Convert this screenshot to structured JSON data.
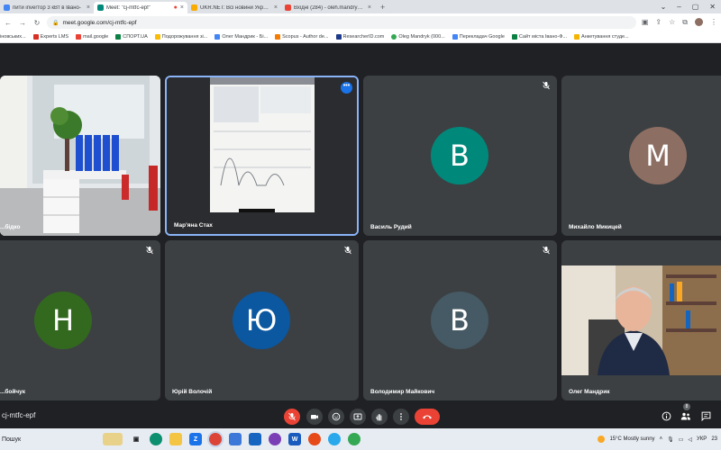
{
  "browser": {
    "tabs": [
      {
        "label": "пити inverтор 3 кВт в Івано-",
        "active": false,
        "favicon_color": "#4285f4"
      },
      {
        "label": "Meet: \"cj-mtfc-epf\"",
        "active": true,
        "favicon_color": "#00897b"
      },
      {
        "label": "UKR.NET: Всі новини України, о...",
        "active": false,
        "favicon_color": "#f9ab00"
      },
      {
        "label": "Вхідні (284) - oleh.mandryk@nu...",
        "active": false,
        "favicon_color": "#ea4335"
      }
    ],
    "new_tab": "+",
    "url": "meet.google.com/cj-mtfc-epf",
    "bookmarks": [
      {
        "label": "іновських...",
        "color": "#1a73e8"
      },
      {
        "label": "Experts LMS",
        "color": "#d93025"
      },
      {
        "label": "mail.google",
        "color": "#ea4335"
      },
      {
        "label": "СПОРТ.UA",
        "color": "#0b8043"
      },
      {
        "label": "Подорожування зі...",
        "color": "#fbbc04"
      },
      {
        "label": "Олег Мандрик - Бі...",
        "color": "#4285f4"
      },
      {
        "label": "Scopus - Author de...",
        "color": "#f57c00"
      },
      {
        "label": "ResearcherID.com",
        "color": "#1e3a8a"
      },
      {
        "label": "Oleg Mandryk (000...",
        "color": "#34a853"
      },
      {
        "label": "Перекладач Google",
        "color": "#4285f4"
      },
      {
        "label": "Сайт міста Івано-Ф...",
        "color": "#0b8043"
      },
      {
        "label": "Анкетування студе...",
        "color": "#f4b400"
      }
    ]
  },
  "participants": [
    {
      "name": "...бідко",
      "type": "video-office"
    },
    {
      "name": "Мар'яна Стах",
      "type": "video-screen",
      "pinned": true
    },
    {
      "name": "Василь Рудий",
      "type": "avatar",
      "initial": "В",
      "color": "#00897b",
      "muted": true
    },
    {
      "name": "Михайло Микицей",
      "type": "avatar",
      "initial": "М",
      "color": "#8d6e63",
      "muted": false
    },
    {
      "name": "...бойчук",
      "type": "avatar",
      "initial": "Н",
      "color": "#33691e",
      "muted": true
    },
    {
      "name": "Юрій Волочій",
      "type": "avatar",
      "initial": "Ю",
      "color": "#0b57a0",
      "muted": true
    },
    {
      "name": "Володимир Майкович",
      "type": "avatar",
      "initial": "В",
      "color": "#455a64",
      "muted": true
    },
    {
      "name": "Олег Мандрик",
      "type": "video-person",
      "muted": false
    }
  ],
  "controls": {
    "meeting_code": "cj-mtfc-epf",
    "people_badge": "8"
  },
  "taskbar": {
    "search_placeholder": "Пошук",
    "weather": "15°C  Mostly sunny",
    "language": "УКР",
    "time": "23"
  }
}
